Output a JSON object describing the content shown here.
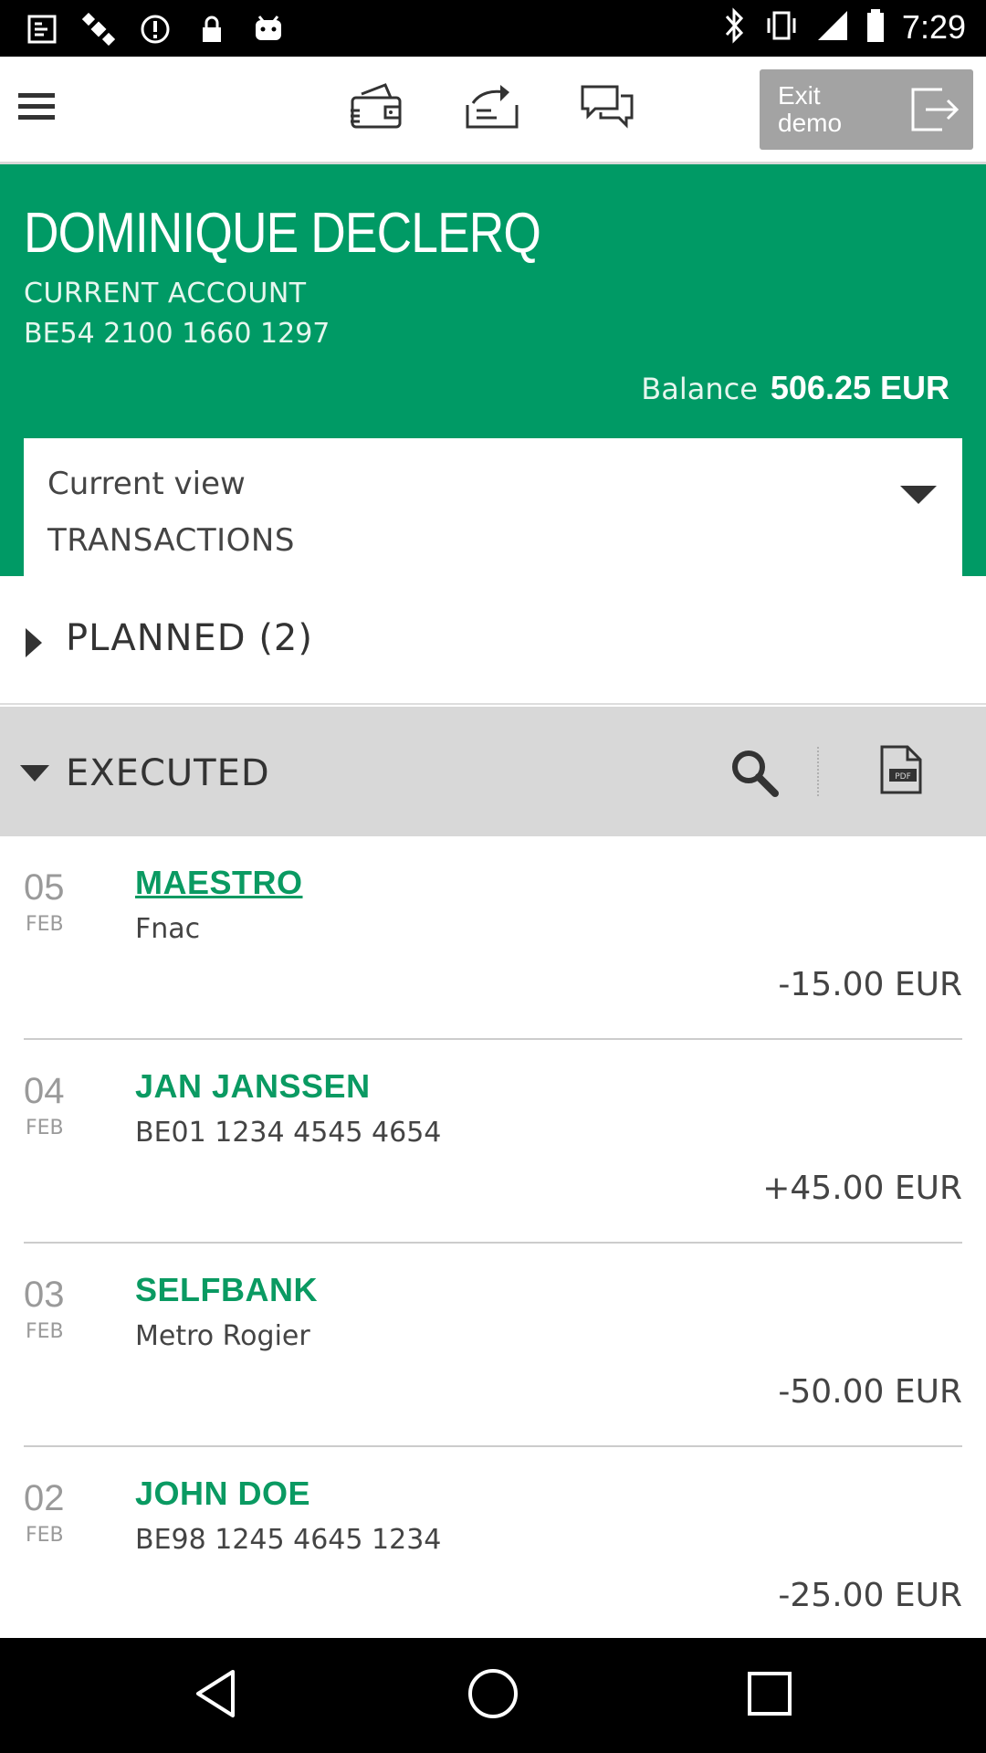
{
  "status_bar": {
    "time": "7:29",
    "left_icons": [
      "fake-gps-icon",
      "satellite-icon",
      "alert-icon",
      "lock-icon",
      "android-icon"
    ],
    "right_icons": [
      "bluetooth-icon",
      "vibrate-icon",
      "signal-icon",
      "battery-icon"
    ]
  },
  "toolbar": {
    "icons": [
      "menu-icon",
      "wallet-icon",
      "transfer-icon",
      "chat-icon"
    ],
    "exit_label": "Exit\ndemo"
  },
  "account": {
    "holder": "DOMINIQUE DECLERQ",
    "type": "CURRENT ACCOUNT",
    "iban": "BE54 2100 1660 1297",
    "balance_label": "Balance",
    "balance_value": "506.25 EUR"
  },
  "view": {
    "label": "Current view",
    "value": "TRANSACTIONS"
  },
  "planned": {
    "label": "PLANNED  (2)"
  },
  "executed": {
    "label": "EXECUTED"
  },
  "transactions": [
    {
      "day": "05",
      "month": "FEB",
      "name": "MAESTRO",
      "detail": "Fnac",
      "amount": "-15.00 EUR"
    },
    {
      "day": "04",
      "month": "FEB",
      "name": "JAN JANSSEN",
      "detail": "BE01 1234 4545 4654",
      "amount": "+45.00 EUR"
    },
    {
      "day": "03",
      "month": "FEB",
      "name": "SELFBANK",
      "detail": "Metro Rogier",
      "amount": "-50.00 EUR"
    },
    {
      "day": "02",
      "month": "FEB",
      "name": "JOHN DOE",
      "detail": "BE98 1245 4645 1234",
      "amount": "-25.00 EUR"
    }
  ],
  "colors": {
    "brand_green": "#009a65",
    "link_green": "#0a9a62"
  }
}
